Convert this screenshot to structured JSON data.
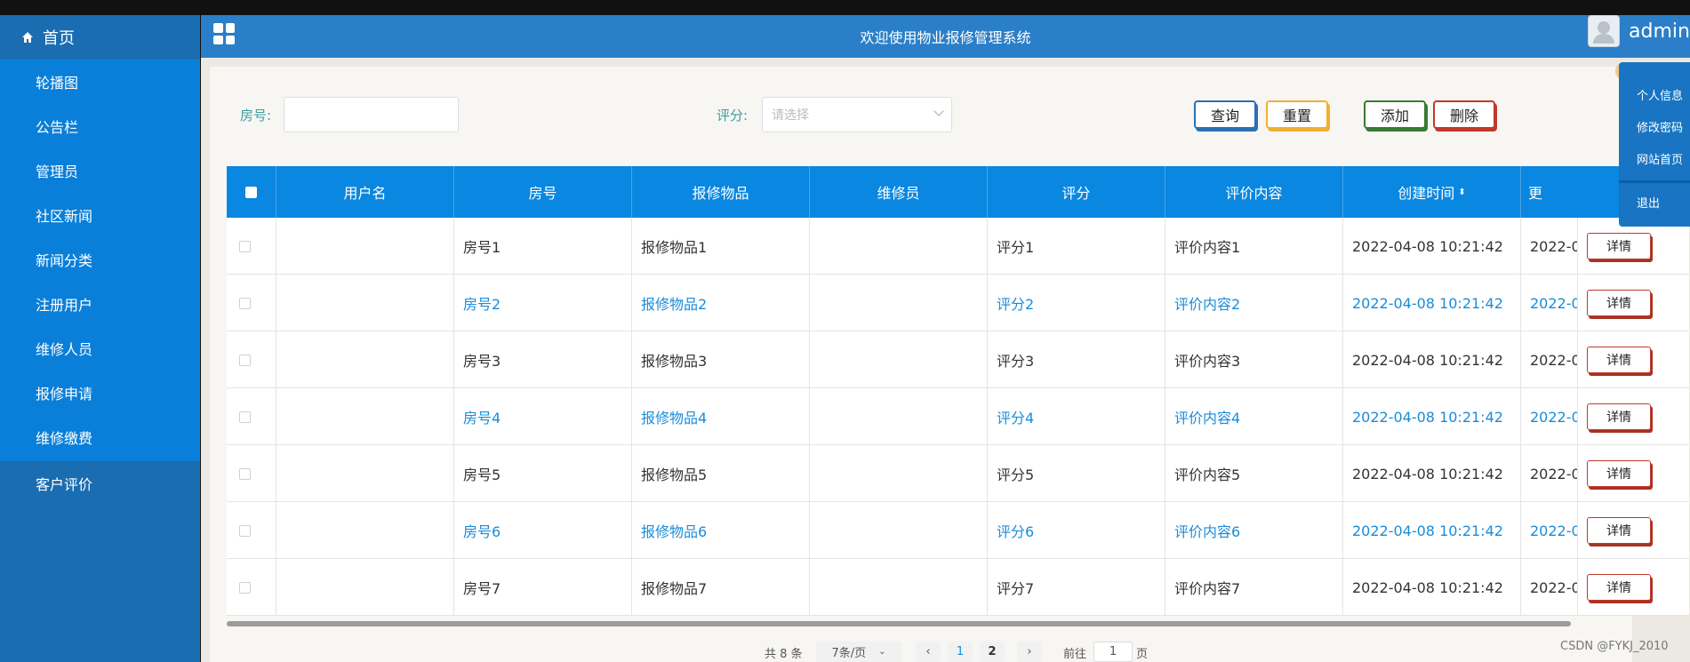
{
  "header": {
    "title": "欢迎使用物业报修管理系统",
    "user": "admin"
  },
  "sidebar": {
    "home": "首页",
    "items": [
      "轮播图",
      "公告栏",
      "管理员",
      "社区新闻",
      "新闻分类",
      "注册用户",
      "维修人员",
      "报修申请",
      "维修缴费",
      "客户评价"
    ]
  },
  "search": {
    "room_label": "房号:",
    "room_value": "",
    "rating_label": "评分:",
    "rating_placeholder": "请选择"
  },
  "buttons": {
    "query": "查询",
    "reset": "重置",
    "add": "添加",
    "delete": "删除"
  },
  "table": {
    "headers": [
      "用户名",
      "房号",
      "报修物品",
      "维修员",
      "评分",
      "评价内容",
      "创建时间",
      "更"
    ],
    "sort_icon": "⬍",
    "rows": [
      {
        "user": "",
        "room": "房号1",
        "item": "报修物品1",
        "repairer": "",
        "rating": "评分1",
        "content": "评价内容1",
        "created": "2022-04-08 10:21:42",
        "updated": "2022-0"
      },
      {
        "user": "",
        "room": "房号2",
        "item": "报修物品2",
        "repairer": "",
        "rating": "评分2",
        "content": "评价内容2",
        "created": "2022-04-08 10:21:42",
        "updated": "2022-0"
      },
      {
        "user": "",
        "room": "房号3",
        "item": "报修物品3",
        "repairer": "",
        "rating": "评分3",
        "content": "评价内容3",
        "created": "2022-04-08 10:21:42",
        "updated": "2022-0"
      },
      {
        "user": "",
        "room": "房号4",
        "item": "报修物品4",
        "repairer": "",
        "rating": "评分4",
        "content": "评价内容4",
        "created": "2022-04-08 10:21:42",
        "updated": "2022-0"
      },
      {
        "user": "",
        "room": "房号5",
        "item": "报修物品5",
        "repairer": "",
        "rating": "评分5",
        "content": "评价内容5",
        "created": "2022-04-08 10:21:42",
        "updated": "2022-0"
      },
      {
        "user": "",
        "room": "房号6",
        "item": "报修物品6",
        "repairer": "",
        "rating": "评分6",
        "content": "评价内容6",
        "created": "2022-04-08 10:21:42",
        "updated": "2022-0"
      },
      {
        "user": "",
        "room": "房号7",
        "item": "报修物品7",
        "repairer": "",
        "rating": "评分7",
        "content": "评价内容7",
        "created": "2022-04-08 10:21:42",
        "updated": "2022-0"
      }
    ],
    "detail_label": "详情"
  },
  "pagination": {
    "total": "共 8 条",
    "page_size": "7条/页",
    "prev": "‹",
    "pages": [
      "1",
      "2"
    ],
    "current": "1",
    "next": "›",
    "goto_label": "前往",
    "goto_value": "1",
    "page_suffix": "页"
  },
  "user_menu": {
    "items": [
      "个人信息",
      "修改密码",
      "网站首页",
      "退出"
    ]
  },
  "watermark": "CSDN @FYKJ_2010",
  "colors": {
    "sidebar": "#1a6db0",
    "sidebar_menu": "#0a7fd9",
    "header": "#2b7fc8",
    "table_head": "#0a87e0",
    "link_text": "#1a8cd8"
  }
}
